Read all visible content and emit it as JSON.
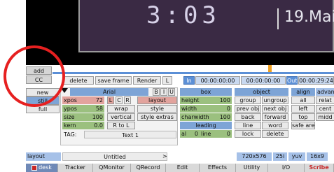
{
  "preview": {
    "time_text": "3:03",
    "date_text": "19.Mai"
  },
  "left_tabs": [
    "add",
    "CC"
  ],
  "side_buttons": [
    "new",
    "still",
    "full"
  ],
  "toolbar": {
    "delete": "delete",
    "save_frame": "save frame",
    "render": "Render",
    "l": "L",
    "in_label": "In",
    "in_tc1": "00:00:00:00",
    "in_tc2": "00:00:00:00",
    "out_label": "Out",
    "out_tc": "00:00:29:24"
  },
  "font_panel": {
    "font_name": "Arial",
    "b": "B",
    "i": "I",
    "u": "U",
    "rows": [
      {
        "label": "xpos",
        "value": "72"
      },
      {
        "label": "ypos",
        "value": "58"
      },
      {
        "label": "size",
        "value": "100"
      },
      {
        "label": "kern",
        "value": "0.0"
      }
    ],
    "l": "L",
    "c": "C",
    "r": "R",
    "wrap": "wrap",
    "vertical": "vertical",
    "r_to_l": "R to L",
    "layout": "layout",
    "style": "style",
    "style_extras": "style extras",
    "tag_label": "TAG:",
    "tag_value": "Text 1"
  },
  "box_panel": {
    "title": "box",
    "rows": [
      {
        "label": "height",
        "value": "100"
      },
      {
        "label": "width",
        "value": "0"
      },
      {
        "label": "charwidth",
        "value": "100"
      }
    ],
    "leading": "leading",
    "al": "al",
    "al_val": "0",
    "line": "line",
    "line_val": "0"
  },
  "object_panel": {
    "title": "object",
    "buttons": [
      [
        "group",
        "ungroup"
      ],
      [
        "prev obj",
        "next obj"
      ],
      [
        "back",
        "forward"
      ],
      [
        "line",
        "word"
      ],
      [
        "lock",
        "delete"
      ]
    ]
  },
  "align_panel": {
    "title": "align",
    "advanced": "advan",
    "buttons": [
      [
        "all",
        "relat"
      ],
      [
        "left",
        "cent"
      ],
      [
        "top",
        "midd"
      ],
      [
        "safe area",
        ""
      ]
    ]
  },
  "bottom": {
    "layout": "layout",
    "untitled": "Untitled",
    "arrow": ">",
    "res": "720x576",
    "fps": "25i",
    "yuv": "yuv",
    "aspect": "16x9"
  },
  "tabs": [
    "desk",
    "Tracker",
    "QMonitor",
    "QRecord",
    "Edit",
    "Effects",
    "Utility",
    "I/O",
    "Scribe"
  ],
  "colors": {
    "green": "#9bc07f",
    "blue": "#7da4d6",
    "salmon": "#e2a39d",
    "preview_bg": "#3a2a44",
    "highlight": "#e62020"
  }
}
